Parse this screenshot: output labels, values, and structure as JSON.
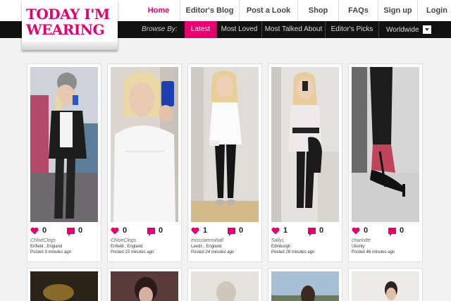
{
  "site": {
    "logo_line1": "TODAY I'M",
    "logo_line2": "WEARING"
  },
  "topnav": [
    {
      "label": "Home",
      "active": true
    },
    {
      "label": "Editor's Blog",
      "active": false
    },
    {
      "label": "Post a Look",
      "active": false
    },
    {
      "label": "Shop",
      "active": false
    },
    {
      "label": "FAQs",
      "active": false
    },
    {
      "label": "Sign up",
      "active": false
    },
    {
      "label": "Login",
      "active": false
    }
  ],
  "browse": {
    "label": "Browse By:",
    "tabs": [
      {
        "label": "Latest",
        "active": true
      },
      {
        "label": "Most Loved",
        "active": false
      },
      {
        "label": "Most Talked About",
        "active": false
      },
      {
        "label": "Editor's Picks",
        "active": false
      }
    ],
    "region_select": "Worldwide"
  },
  "colors": {
    "accent": "#e6006e",
    "bar": "#111111"
  },
  "icons": {
    "like": "heart-icon",
    "comment": "comment-bubble-icon"
  },
  "looks": [
    {
      "likes": "0",
      "comments": "0",
      "user": "ChloeClogs",
      "location": "Enfield , England",
      "posted_prefix": "Posted ",
      "posted_time": "9 minutes ago"
    },
    {
      "likes": "0",
      "comments": "0",
      "user": "ChloeClogs",
      "location": "Enfield , England",
      "posted_prefix": "Posted ",
      "posted_time": "15 minutes ago"
    },
    {
      "likes": "1",
      "comments": "0",
      "user": "misssammihall",
      "location": "Leeds , England",
      "posted_prefix": "Posted ",
      "posted_time": "24 minutes ago"
    },
    {
      "likes": "1",
      "comments": "0",
      "user": "SallyL",
      "location": "Edinburgh",
      "posted_prefix": "Posted ",
      "posted_time": "28 minutes ago"
    },
    {
      "likes": "0",
      "comments": "0",
      "user": "charlotte",
      "location": "Ukonly",
      "posted_prefix": "Posted ",
      "posted_time": "46 minutes ago"
    }
  ]
}
